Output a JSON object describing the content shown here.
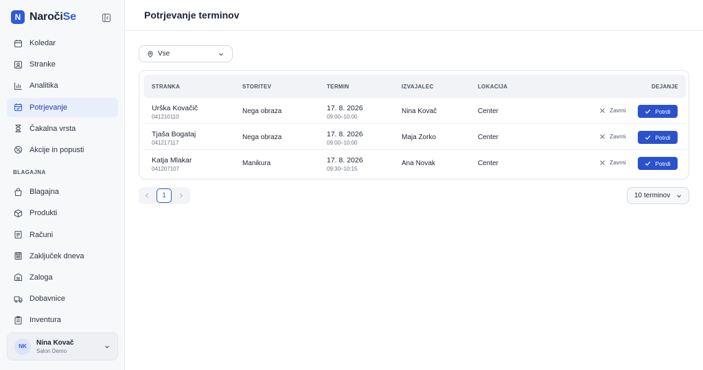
{
  "brand": {
    "logo_letter": "N",
    "name_part1": "Naroči",
    "name_part2": "Se",
    "accent_color": "#2e5bd8"
  },
  "sidebar": {
    "items": [
      {
        "label": "Koledar",
        "icon": "calendar-icon"
      },
      {
        "label": "Stranke",
        "icon": "contact-icon"
      },
      {
        "label": "Analitika",
        "icon": "bar-chart-icon"
      },
      {
        "label": "Potrjevanje",
        "icon": "calendar-check-icon",
        "active": true
      },
      {
        "label": "Čakalna vrsta",
        "icon": "hourglass-icon"
      },
      {
        "label": "Akcije in popusti",
        "icon": "discount-icon"
      }
    ],
    "section_label": "BLAGAJNA",
    "section_items": [
      {
        "label": "Blagajna",
        "icon": "register-icon"
      },
      {
        "label": "Produkti",
        "icon": "box-icon"
      },
      {
        "label": "Računi",
        "icon": "receipt-icon"
      },
      {
        "label": "Zaključek dneva",
        "icon": "calculator-icon"
      },
      {
        "label": "Zaloga",
        "icon": "warehouse-icon"
      },
      {
        "label": "Dobavnice",
        "icon": "truck-icon"
      },
      {
        "label": "Inventura",
        "icon": "clipboard-icon"
      }
    ]
  },
  "user": {
    "initials": "NK",
    "name": "Nina Kovač",
    "subtitle": "Salon Demo"
  },
  "header": {
    "title": "Potrjevanje terminov"
  },
  "filter": {
    "location_value": "Vse"
  },
  "table": {
    "columns": [
      "STRANKA",
      "STORITEV",
      "TERMIN",
      "IZVAJALEC",
      "LOKACIJA",
      "DEJANJE"
    ],
    "reject_label": "Zavrni",
    "confirm_label": "Potrdi",
    "rows": [
      {
        "client": "Urška Kovačič",
        "phone": "041210110",
        "service": "Nega obraza",
        "date": "17. 8. 2026",
        "time": "09:00–10:00",
        "staff": "Nina Kovač",
        "location": "Center"
      },
      {
        "client": "Tjaša Bogataj",
        "phone": "041217117",
        "service": "Nega obraza",
        "date": "17. 8. 2026",
        "time": "09:00–10:00",
        "staff": "Maja Zorko",
        "location": "Center"
      },
      {
        "client": "Katja Mlakar",
        "phone": "041207107",
        "service": "Manikura",
        "date": "17. 8. 2026",
        "time": "09:30–10:15",
        "staff": "Ana Novak",
        "location": "Center"
      }
    ]
  },
  "pagination": {
    "current_page": "1",
    "per_page_label": "10 terminov"
  }
}
